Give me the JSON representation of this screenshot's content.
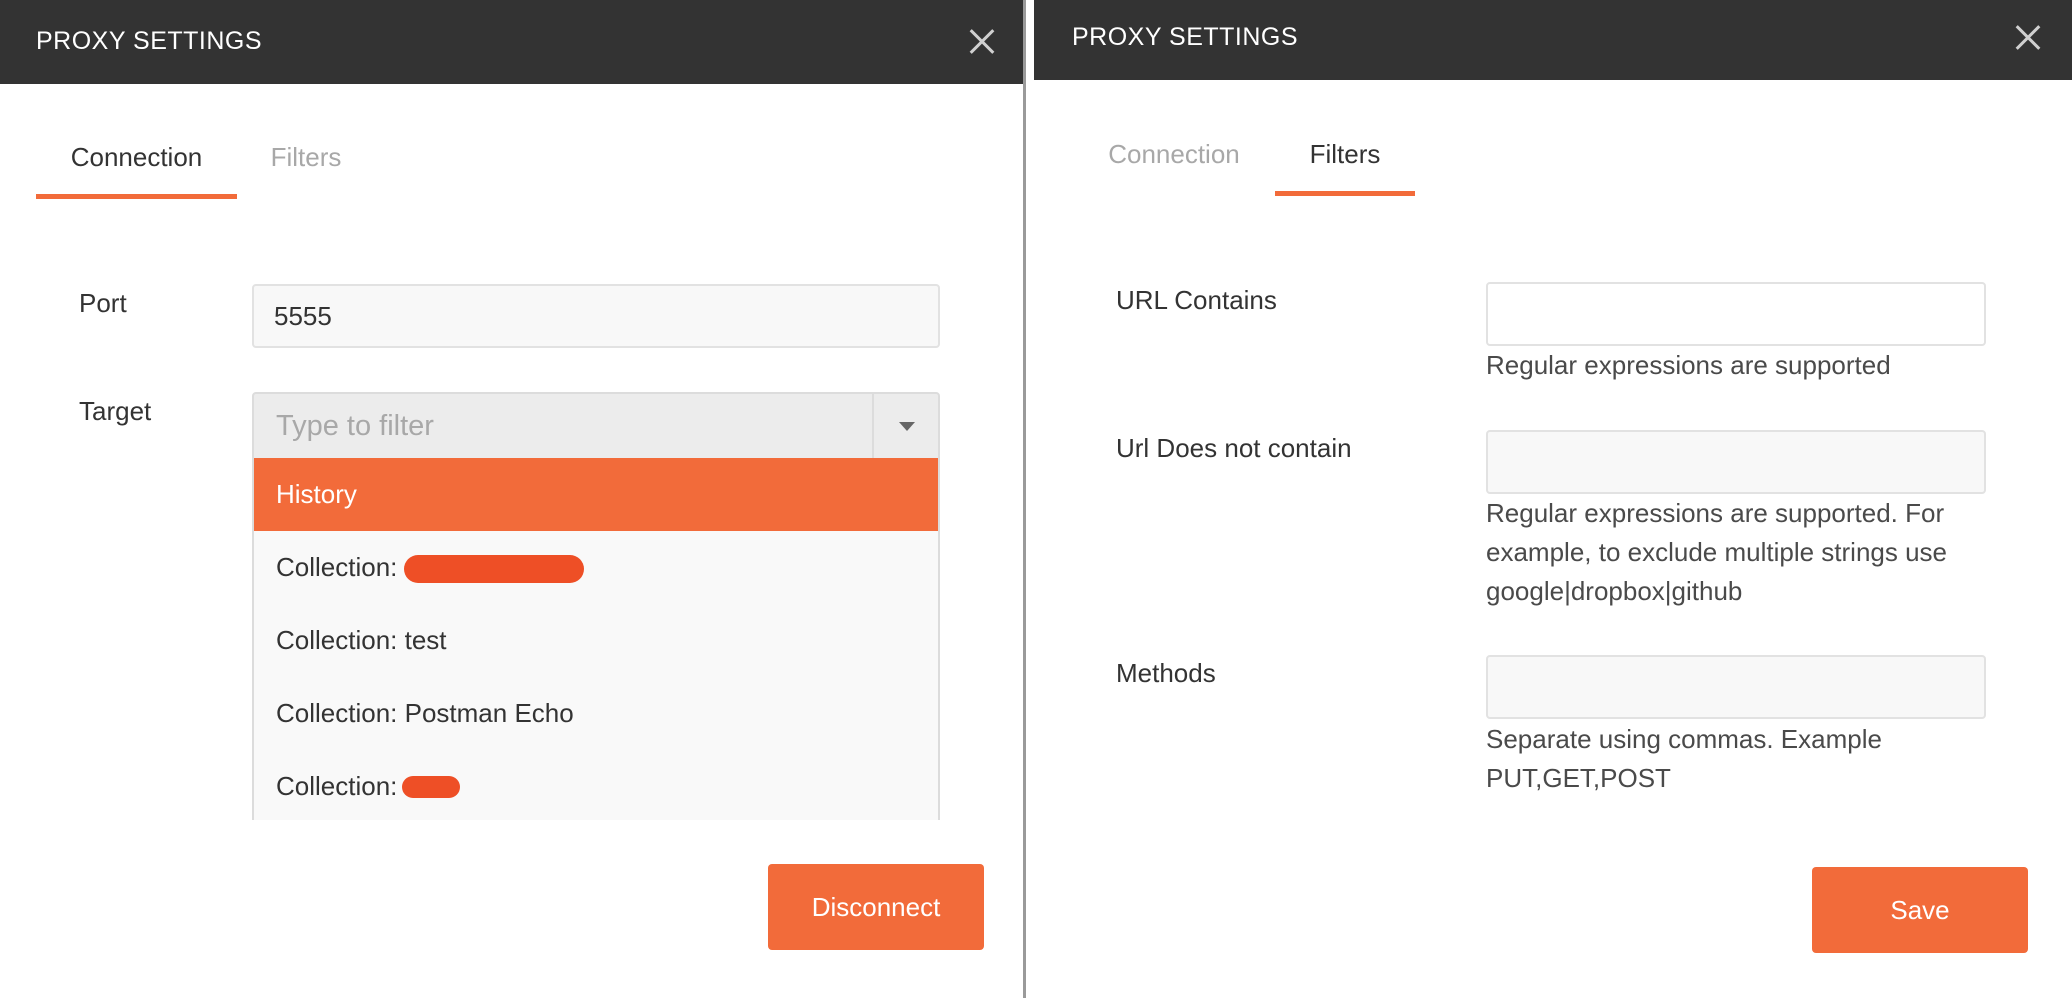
{
  "left_dialog": {
    "title": "PROXY SETTINGS",
    "tabs": [
      {
        "label": "Connection",
        "active": true
      },
      {
        "label": "Filters",
        "active": false
      }
    ],
    "port": {
      "label": "Port",
      "value": "5555"
    },
    "target": {
      "label": "Target",
      "placeholder": "Type to filter",
      "options": [
        {
          "label": "History",
          "highlighted": true
        },
        {
          "label": "Collection: ",
          "redacted": true
        },
        {
          "label": "Collection: test"
        },
        {
          "label": "Collection: Postman Echo"
        },
        {
          "label": "Collection:",
          "redacted": true
        }
      ]
    },
    "primary_button": "Disconnect"
  },
  "right_dialog": {
    "title": "PROXY SETTINGS",
    "tabs": [
      {
        "label": "Connection",
        "active": false
      },
      {
        "label": "Filters",
        "active": true
      }
    ],
    "url_contains": {
      "label": "URL Contains",
      "value": "",
      "help": "Regular expressions are supported"
    },
    "url_not_contains": {
      "label": "Url Does not contain",
      "value": "",
      "help": "Regular expressions are supported. For\nexample, to exclude multiple strings use\ngoogle|dropbox|github"
    },
    "methods": {
      "label": "Methods",
      "value": "",
      "help": "Separate using commas. Example\nPUT,GET,POST"
    },
    "primary_button": "Save"
  },
  "colors": {
    "accent": "#f26b3a",
    "titlebar": "#333333",
    "redaction": "#ee4f26"
  }
}
